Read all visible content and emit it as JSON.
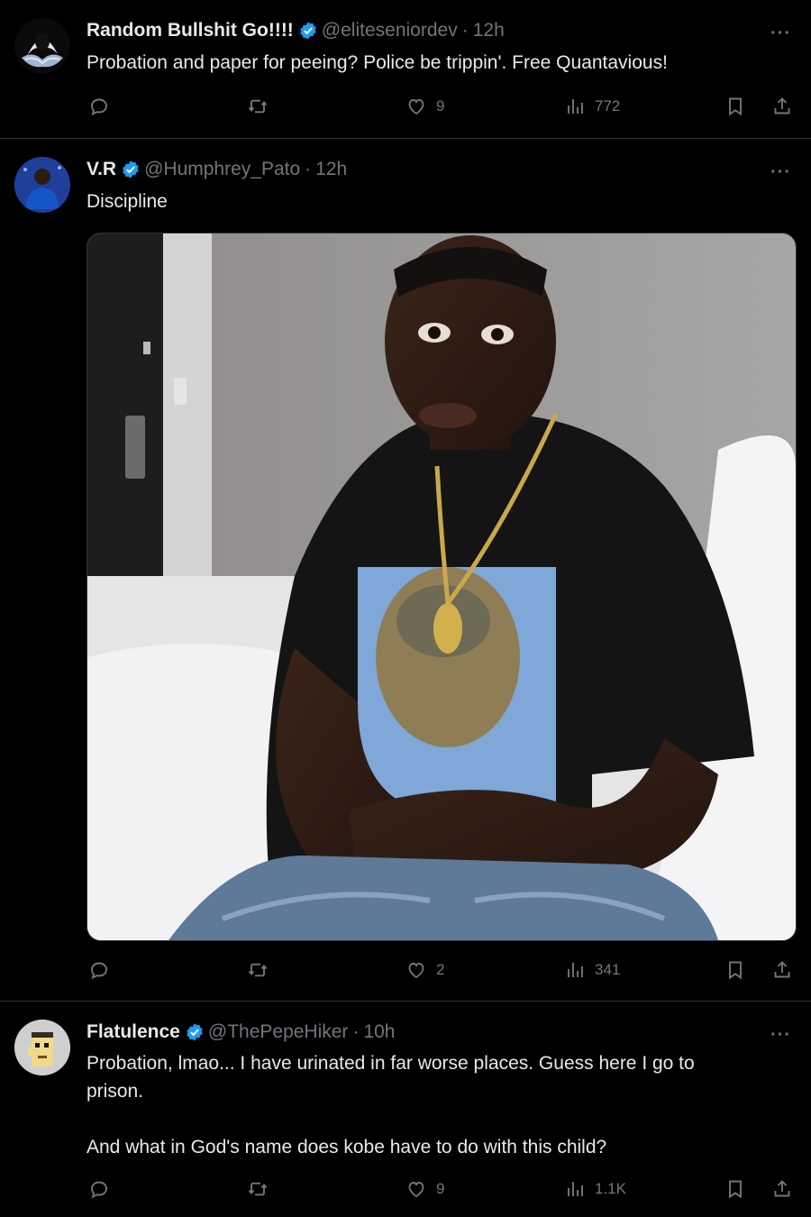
{
  "tweets": [
    {
      "name": "Random Bullshit Go!!!!",
      "handle": "@eliteseniordev",
      "time": "12h",
      "text": [
        "Probation and paper for peeing? Police be trippin'. Free Quantavious!"
      ],
      "likes": "9",
      "views": "772"
    },
    {
      "name": "V.R",
      "handle": "@Humphrey_Pato",
      "time": "12h",
      "text": [
        "Discipline"
      ],
      "likes": "2",
      "views": "341",
      "media": "photo of a man in a black t-shirt with a gold chain sitting on a hotel bed"
    },
    {
      "name": "Flatulence",
      "handle": "@ThePepeHiker",
      "time": "10h",
      "text": [
        "Probation, lmao... I have urinated in far worse places. Guess here I go to",
        "prison.",
        "",
        "And what in God's name does kobe have to do with this child?"
      ],
      "likes": "9",
      "views": "1.1K"
    }
  ],
  "icons": {
    "reply": "reply-icon",
    "retweet": "retweet-icon",
    "like": "heart-icon",
    "views": "views-icon",
    "bookmark": "bookmark-icon",
    "share": "share-icon",
    "verified": "verified-badge-icon",
    "more": "more-options-icon"
  },
  "colors": {
    "background": "#000000",
    "text": "#e7e9ea",
    "secondary": "#71767b",
    "verified": "#1d9bf0",
    "divider": "#2f3336"
  }
}
